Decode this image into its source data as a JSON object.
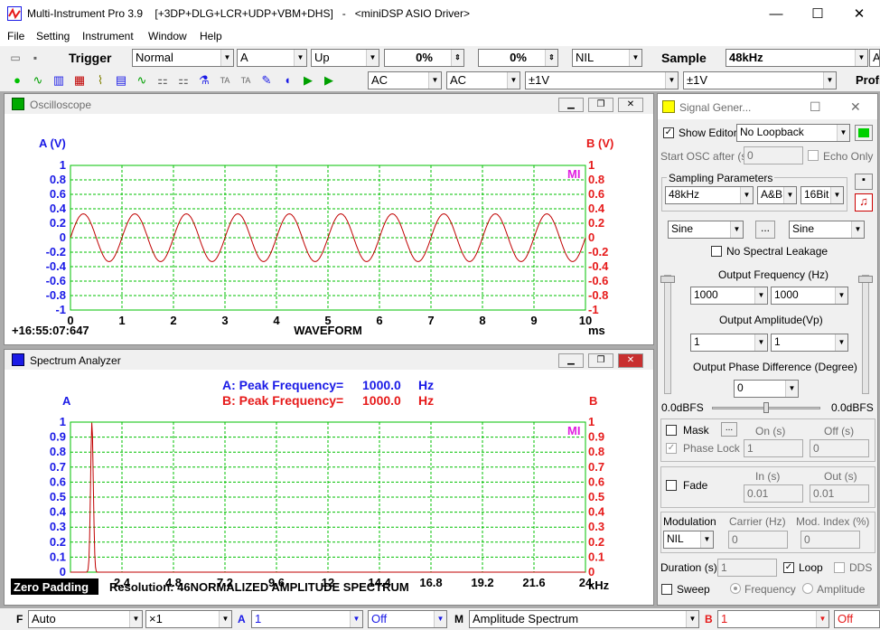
{
  "window": {
    "title": "Multi-Instrument Pro 3.9    [+3DP+DLG+LCR+UDP+VBM+DHS]   -   <miniDSP ASIO Driver>",
    "minimize_glyph": "—",
    "maximize_glyph": "☐",
    "close_glyph": "✕"
  },
  "menu": [
    "File",
    "Setting",
    "Instrument",
    "Window",
    "Help"
  ],
  "toolbar1": {
    "trigger_label": "Trigger",
    "trigger_mode": "Normal",
    "trigger_channel": "A",
    "trigger_edge": "Up",
    "pos1": "0%",
    "pos2": "0%",
    "nil": "NIL",
    "sample_label": "Sample",
    "sample_rate": "48kHz",
    "far_right": "A"
  },
  "toolbar2": {
    "coupling_a": "AC",
    "coupling_b": "AC",
    "range_a": "±1V",
    "range_b": "±1V",
    "profile": "Profi",
    "icons": [
      "record-icon",
      "oscilloscope-icon",
      "spectrum-icon",
      "multimeter-icon",
      "phase-icon",
      "dds-icon",
      "signal-gen-icon",
      "dp-icon",
      "ddc-icon",
      "probe-icon",
      "ta-icon",
      "tb-icon",
      "tools-icon",
      "speaker-icon",
      "play-icon",
      "play-once-icon"
    ],
    "icon_glyphs": [
      "●",
      "∿",
      "▥",
      "▦",
      "⌇",
      "▤",
      "∿",
      "⚏",
      "⚏",
      "⚗",
      "TA",
      "TA",
      "✎",
      "◖",
      "▶",
      "▶"
    ]
  },
  "oscilloscope": {
    "window_title": "Oscilloscope",
    "left_axis": "A (V)",
    "right_axis": "B (V)",
    "timestamp": "+16:55:07:647",
    "xlabel": "WAVEFORM",
    "xunit": "ms",
    "mi": "MI",
    "y_ticks": [
      "1",
      "0.8",
      "0.6",
      "0.4",
      "0.2",
      "0",
      "-0.2",
      "-0.4",
      "-0.6",
      "-0.8",
      "-1"
    ],
    "x_ticks": [
      "0",
      "1",
      "2",
      "3",
      "4",
      "5",
      "6",
      "7",
      "8",
      "9",
      "10"
    ]
  },
  "spectrum": {
    "window_title": "Spectrum Analyzer",
    "peak_a_label": "A: Peak Frequency=",
    "peak_a_value": "1000.0",
    "peak_a_unit": "Hz",
    "peak_b_label": "B: Peak Frequency=",
    "peak_b_value": "1000.0",
    "peak_b_unit": "Hz",
    "left_axis": "A",
    "right_axis": "B",
    "mi": "MI",
    "y_ticks": [
      "1",
      "0.9",
      "0.8",
      "0.7",
      "0.6",
      "0.5",
      "0.4",
      "0.3",
      "0.2",
      "0.1",
      "0"
    ],
    "x_ticks": [
      "0",
      "2.4",
      "4.8",
      "7.2",
      "9.6",
      "12",
      "14.4",
      "16.8",
      "19.2",
      "21.6",
      "24"
    ],
    "xunit": "kHz",
    "zero_padding": "Zero Padding",
    "resolution_overlap": "Resolution: 46NORMALIZED AMPLITUDE SPECTRUM"
  },
  "chart_data": [
    {
      "type": "line",
      "title": "WAVEFORM",
      "xlabel": "ms",
      "ylabel": "A (V)",
      "ylabel_right": "B (V)",
      "xlim": [
        0,
        10
      ],
      "ylim": [
        -1,
        1
      ],
      "grid": true,
      "series": [
        {
          "frequency_hz": 1000,
          "amplitude": 0.33,
          "color": "#c00000"
        }
      ]
    },
    {
      "type": "line",
      "title": "NORMALIZED AMPLITUDE SPECTRUM",
      "xlabel": "kHz",
      "ylabel": "A",
      "ylabel_right": "B",
      "xlim": [
        0,
        24
      ],
      "ylim": [
        0,
        1
      ],
      "grid": true,
      "series": [
        {
          "peak_khz": 1.0,
          "peak_value": 1.0,
          "color": "#c00000"
        }
      ]
    }
  ],
  "signal_gen": {
    "title": "Signal Gener...",
    "show_editor": "Show Editor",
    "loopback": "No Loopback",
    "start_osc": "Start OSC after (s)",
    "start_osc_val": "0",
    "echo_only": "Echo Only",
    "sampling_params": "Sampling Parameters",
    "rate": "48kHz",
    "channels": "A&B",
    "bits": "16Bit",
    "wave_a": "Sine",
    "wave_b": "Sine",
    "dots": "...",
    "no_leakage": "No Spectral Leakage",
    "out_freq": "Output Frequency (Hz)",
    "freq_a": "1000",
    "freq_b": "1000",
    "out_amp": "Output Amplitude(Vp)",
    "amp_a": "1",
    "amp_b": "1",
    "phase_diff": "Output Phase Difference (Degree)",
    "phase": "0",
    "dbfs_l": "0.0dBFS",
    "dbfs_r": "0.0dBFS",
    "mask": "Mask",
    "on_s": "On (s)",
    "off_s": "Off (s)",
    "phase_lock": "Phase Lock",
    "on_val": "1",
    "off_val": "0",
    "fade": "Fade",
    "in_s": "In (s)",
    "out_s": "Out (s)",
    "in_val": "0.01",
    "out_val": "0.01",
    "modulation": "Modulation",
    "carrier": "Carrier (Hz)",
    "mod_index": "Mod. Index (%)",
    "mod_type": "NIL",
    "carrier_val": "0",
    "mod_val": "0",
    "duration": "Duration (s)",
    "duration_val": "1",
    "loop": "Loop",
    "dds": "DDS",
    "sweep": "Sweep",
    "frequency": "Frequency",
    "amplitude": "Amplitude"
  },
  "statusbar": {
    "f": "F",
    "auto": "Auto",
    "x1": "×1",
    "a": "A",
    "a_val": "1",
    "off1": "Off",
    "m": "M",
    "mode": "Amplitude Spectrum",
    "b": "B",
    "b_val": "1",
    "off2": "Off"
  },
  "colors": {
    "channel_a": "#1a1ae6",
    "channel_b": "#e61a1a",
    "grid": "#00c000",
    "trace": "#c00000",
    "mi": "#e020e0"
  }
}
